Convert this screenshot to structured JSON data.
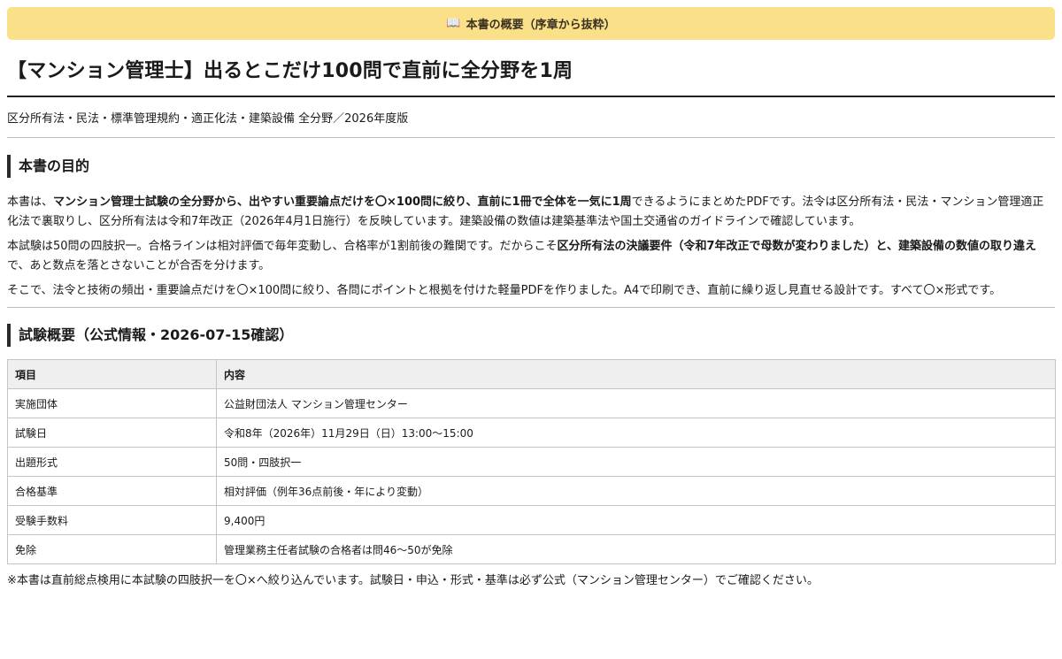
{
  "banner": {
    "icon": "open-book-icon",
    "icon_glyph": "📖",
    "text": "本書の概要（序章から抜粋）",
    "color": "#fbe08a"
  },
  "title": "【マンション管理士】出るとこだけ100問で直前に全分野を1周",
  "subtitle": "区分所有法・民法・標準管理規約・適正化法・建築設備 全分野／2026年度版",
  "purpose": {
    "heading": "本書の目的",
    "p1_a": "本書は、",
    "p1_b": "マンション管理士試験の全分野から、出やすい重要論点だけを〇×100問に絞り、直前に1冊で全体を一気に1周",
    "p1_c": "できるようにまとめたPDFです。法令は区分所有法・民法・マンション管理適正化法で裏取りし、区分所有法は令和7年改正（2026年4月1日施行）を反映しています。建築設備の数値は建築基準法や国土交通省のガイドラインで確認しています。",
    "p2_a": "本試験は50問の四肢択一。合格ラインは相対評価で毎年変動し、合格率が1割前後の難関です。だからこそ",
    "p2_b": "区分所有法の決議要件（令和7年改正で母数が変わりました）と、建築設備の数値の取り違え",
    "p2_c": "で、あと数点を落とさないことが合否を分けます。",
    "p3": "そこで、法令と技術の頻出・重要論点だけを〇×100問に絞り、各問にポイントと根拠を付けた軽量PDFを作りました。A4で印刷でき、直前に繰り返し見直せる設計です。すべて〇×形式です。"
  },
  "overview": {
    "heading": "試験概要（公式情報・2026-07-15確認）",
    "columns": [
      "項目",
      "内容"
    ],
    "rows": [
      [
        "実施団体",
        "公益財団法人 マンション管理センター"
      ],
      [
        "試験日",
        "令和8年（2026年）11月29日（日）13:00〜15:00"
      ],
      [
        "出題形式",
        "50問・四肢択一"
      ],
      [
        "合格基準",
        "相対評価（例年36点前後・年により変動）"
      ],
      [
        "受験手数料",
        "9,400円"
      ],
      [
        "免除",
        "管理業務主任者試験の合格者は問46〜50が免除"
      ]
    ]
  },
  "note": "※本書は直前総点検用に本試験の四肢択一を〇×へ絞り込んでいます。試験日・申込・形式・基準は必ず公式（マンション管理センター）でご確認ください。"
}
